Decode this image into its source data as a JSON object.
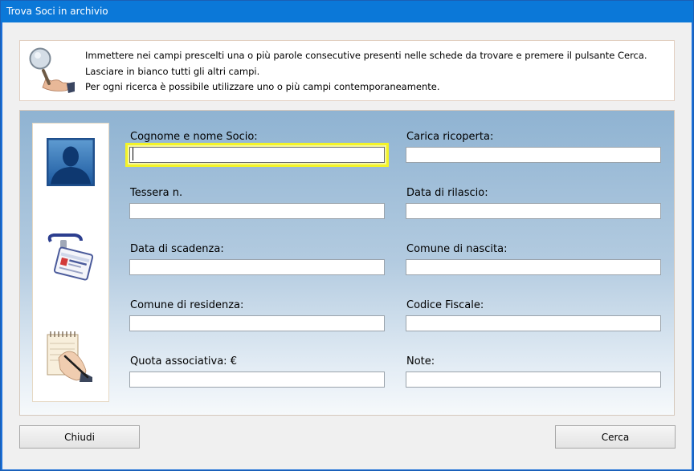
{
  "window": {
    "title": "Trova Soci in archivio"
  },
  "info": {
    "lines": [
      "Immettere nei campi prescelti una o più parole consecutive presenti nelle schede da trovare e premere il pulsante Cerca.",
      "Lasciare in bianco tutti gli altri campi.",
      "Per ogni ricerca è possibile utilizzare uno o più campi contemporaneamente."
    ]
  },
  "fields": {
    "cognome_nome": {
      "label": "Cognome e nome Socio:",
      "value": ""
    },
    "carica": {
      "label": "Carica ricoperta:",
      "value": ""
    },
    "tessera": {
      "label": "Tessera n.",
      "value": ""
    },
    "data_rilascio": {
      "label": "Data di rilascio:",
      "value": ""
    },
    "data_scadenza": {
      "label": "Data di scadenza:",
      "value": ""
    },
    "comune_nascita": {
      "label": "Comune di nascita:",
      "value": ""
    },
    "comune_residenza": {
      "label": "Comune di residenza:",
      "value": ""
    },
    "codice_fiscale": {
      "label": "Codice Fiscale:",
      "value": ""
    },
    "quota": {
      "label": "Quota associativa: €",
      "value": ""
    },
    "note": {
      "label": "Note:",
      "value": ""
    }
  },
  "buttons": {
    "close": "Chiudi",
    "search": "Cerca"
  },
  "icons": [
    "magnifier-icon",
    "person-silhouette-icon",
    "id-badge-icon",
    "notepad-writing-icon"
  ],
  "colors": {
    "titlebar": "#0b78d8",
    "focus": "#f3f327"
  }
}
